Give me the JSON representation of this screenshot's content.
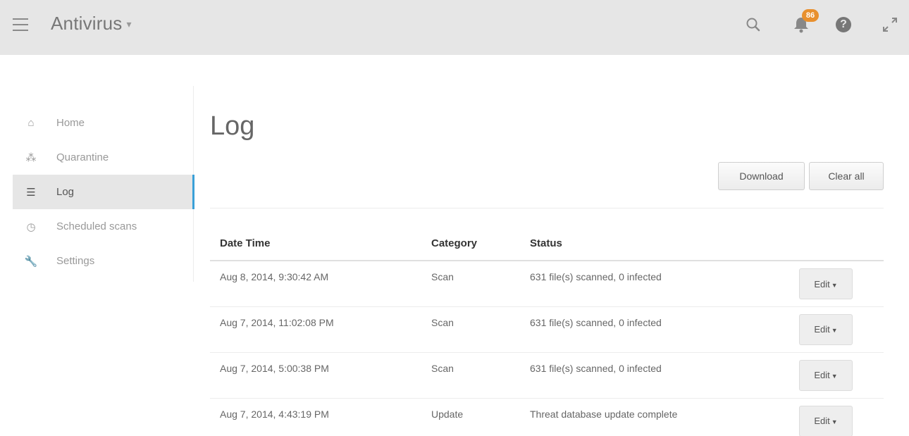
{
  "app": {
    "title": "Antivirus",
    "caret": "▾"
  },
  "header": {
    "notification_count": "86",
    "help_glyph": "?"
  },
  "sidebar": {
    "items": [
      {
        "label": "Home",
        "icon": "home-icon",
        "glyph": "⌂"
      },
      {
        "label": "Quarantine",
        "icon": "biohazard-icon",
        "glyph": "⁂"
      },
      {
        "label": "Log",
        "icon": "list-icon",
        "glyph": "☰",
        "active": true
      },
      {
        "label": "Scheduled scans",
        "icon": "clock-icon",
        "glyph": "◷"
      },
      {
        "label": "Settings",
        "icon": "wrench-icon",
        "glyph": "🔧"
      }
    ]
  },
  "main": {
    "title": "Log",
    "download_label": "Download",
    "clear_label": "Clear all",
    "columns": [
      "Date Time",
      "Category",
      "Status"
    ],
    "rows": [
      {
        "date": "Aug 8, 2014, 9:30:42 AM",
        "category": "Scan",
        "status": "631 file(s) scanned, 0 infected",
        "action": "Edit"
      },
      {
        "date": "Aug 7, 2014, 11:02:08 PM",
        "category": "Scan",
        "status": "631 file(s) scanned, 0 infected",
        "action": "Edit"
      },
      {
        "date": "Aug 7, 2014, 5:00:38 PM",
        "category": "Scan",
        "status": "631 file(s) scanned, 0 infected",
        "action": "Edit"
      },
      {
        "date": "Aug 7, 2014, 4:43:19 PM",
        "category": "Update",
        "status": "Threat database update complete",
        "action": "Edit"
      }
    ]
  },
  "colors": {
    "accent": "#3aa0d8",
    "badge": "#e8902e",
    "topbar": "#e6e6e6"
  }
}
